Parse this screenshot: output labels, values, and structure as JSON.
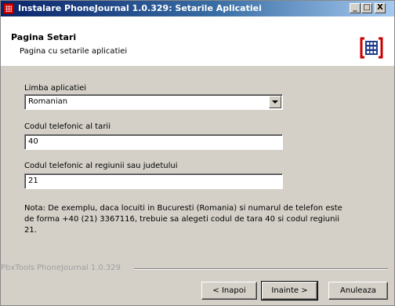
{
  "window": {
    "title": "Instalare PhoneJournal 1.0.329: Setarile Aplicatiei",
    "minimize_label": "_",
    "maximize_label": "□",
    "close_label": "X"
  },
  "header": {
    "title": "Pagina Setari",
    "subtitle": "Pagina cu setarile aplicatiei"
  },
  "form": {
    "language_label": "Limba aplicatiei",
    "language_value": "Romanian",
    "country_code_label": "Codul telefonic al tarii",
    "country_code_value": "40",
    "region_code_label": "Codul telefonic al regiunii sau judetului",
    "region_code_value": "21",
    "note": "Nota: De exemplu, daca locuiti in Bucuresti (Romania) si numarul de telefon este de forma  +40 (21) 3367116,  trebuie sa alegeti codul de tara 40 si codul regiunii 21."
  },
  "footer": {
    "brand": "PbxTools PhoneJournal 1.0.329",
    "back_label": "< Inapoi",
    "next_label": "Inainte >",
    "cancel_label": "Anuleaza"
  },
  "colors": {
    "titlebar_start": "#0a246a",
    "titlebar_end": "#a6caf0",
    "logo_red": "#cc0000",
    "logo_blue": "#1f3c8c"
  }
}
